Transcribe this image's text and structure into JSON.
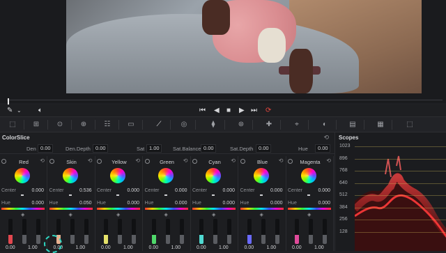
{
  "transport": {
    "icons": [
      "eyedropper-icon",
      "chevron-down-icon",
      "speaker-icon",
      "skip-back-icon",
      "stop-icon",
      "stop-square-icon",
      "play-icon",
      "skip-forward-icon",
      "loop-icon"
    ]
  },
  "toolbar": {
    "tools": [
      "camera-raw-icon",
      "match-icon",
      "primaries-icon",
      "hdr-icon",
      "rgb-mixer-icon",
      "motion-effects-icon",
      "curves-icon",
      "color-warper-icon",
      "qualifier-icon",
      "window-icon",
      "tracker-icon",
      "magic-mask-icon",
      "blur-icon",
      "key-icon",
      "sizing-icon",
      "3d-icon"
    ],
    "active_index": 6
  },
  "colorslice": {
    "title": "ColorSlice",
    "params": [
      {
        "label": "Den",
        "value": "0.00"
      },
      {
        "label": "Den.Depth",
        "value": "0.00"
      },
      {
        "label": "Sat",
        "value": "1.00"
      },
      {
        "label": "Sat.Balance",
        "value": "0.00"
      },
      {
        "label": "Sat.Depth",
        "value": "0.00"
      },
      {
        "label": "Hue",
        "value": "0.00"
      }
    ],
    "center_label": "Center",
    "hue_label": "Hue",
    "columns": [
      {
        "name": "Red",
        "center": "0.000",
        "hue": "0.000",
        "v1": "0.00",
        "v2": "1.00",
        "fill": "#e2474f",
        "level": 0.35
      },
      {
        "name": "Skin",
        "center": "0.536",
        "hue": "0.050",
        "v1": "0.00",
        "v2": "1.00",
        "fill": "#e8b090",
        "level": 0.35
      },
      {
        "name": "Yellow",
        "center": "0.000",
        "hue": "0.000",
        "v1": "0.00",
        "v2": "1.00",
        "fill": "#e6e26a",
        "level": 0.35
      },
      {
        "name": "Green",
        "center": "0.000",
        "hue": "0.000",
        "v1": "0.00",
        "v2": "1.00",
        "fill": "#4fd86a",
        "level": 0.35
      },
      {
        "name": "Cyan",
        "center": "0.000",
        "hue": "0.000",
        "v1": "0.00",
        "v2": "1.00",
        "fill": "#4fd8d0",
        "level": 0.35
      },
      {
        "name": "Blue",
        "center": "0.000",
        "hue": "0.000",
        "v1": "0.00",
        "v2": "1.00",
        "fill": "#6a6aff",
        "level": 0.35
      },
      {
        "name": "Magenta",
        "center": "0.000",
        "hue": "0.000",
        "v1": "0.00",
        "v2": "1.00",
        "fill": "#e04a9a",
        "level": 0.35
      }
    ]
  },
  "scopes": {
    "title": "Scopes",
    "ticks": [
      "1023",
      "896",
      "768",
      "640",
      "512",
      "384",
      "256",
      "128"
    ]
  }
}
